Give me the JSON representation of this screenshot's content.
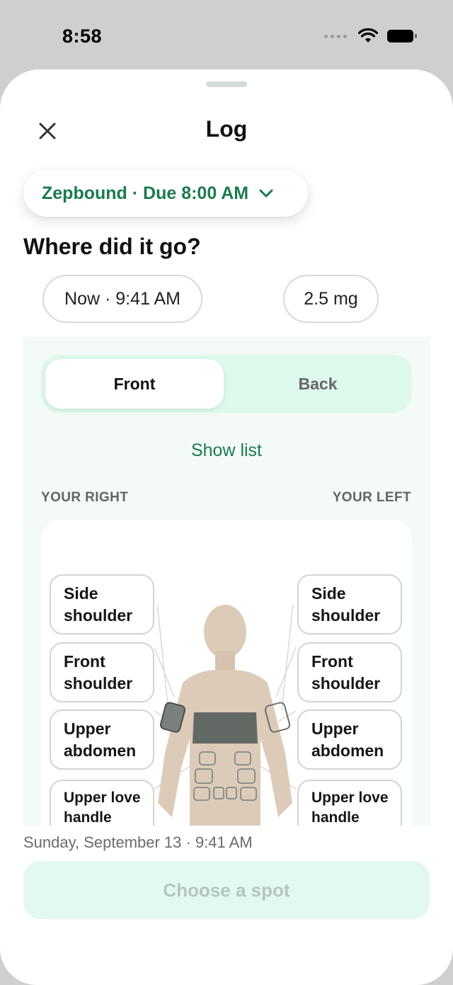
{
  "status_bar": {
    "time": "8:58"
  },
  "header": {
    "title": "Log",
    "close_icon": "close-icon"
  },
  "medication": {
    "label": "Zepbound · Due 8:00 AM",
    "icon": "chevron-down-icon",
    "accent": "#1b7a4f"
  },
  "question": "Where did it go?",
  "chips": {
    "time": "Now · 9:41 AM",
    "dose": "2.5 mg"
  },
  "view_toggle": {
    "front": "Front",
    "back": "Back",
    "selected": "Front"
  },
  "show_list": "Show list",
  "sides": {
    "right": "YOUR RIGHT",
    "left": "YOUR LEFT"
  },
  "spots": {
    "right": [
      {
        "label": "Side shoulder"
      },
      {
        "label": "Front shoulder"
      },
      {
        "label": "Upper abdomen"
      },
      {
        "label": "Upper love handle"
      }
    ],
    "left": [
      {
        "label": "Side shoulder"
      },
      {
        "label": "Front shoulder"
      },
      {
        "label": "Upper abdomen"
      },
      {
        "label": "Upper love handle"
      }
    ]
  },
  "footer": {
    "date": "Sunday, September 13 · 9:41 AM",
    "button": "Choose a spot"
  }
}
